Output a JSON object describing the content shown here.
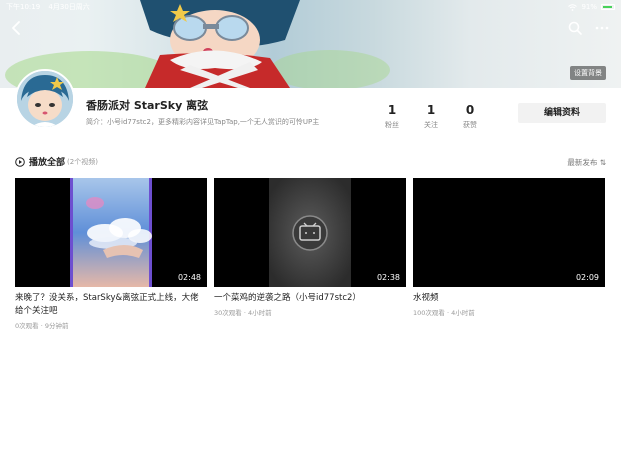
{
  "status_bar": {
    "time": "下午10:19",
    "date": "4月30日周六",
    "battery": "91%"
  },
  "banner": {
    "set_background_label": "设置背景"
  },
  "profile": {
    "username": "香肠派对 StarSky 离弦",
    "bio": "简介：小号id77stc2，更多精彩内容详见TapTap,一个无人赏识的可怜UP主",
    "edit_label": "编辑资料",
    "stats": [
      {
        "value": "1",
        "label": "粉丝"
      },
      {
        "value": "1",
        "label": "关注"
      },
      {
        "value": "0",
        "label": "获赞"
      }
    ]
  },
  "list": {
    "play_all_label": "播放全部",
    "video_count": "(2个视频)",
    "sort_label": "最新发布 ⇅"
  },
  "videos": [
    {
      "title": "来晚了？没关系，StarSky&离弦正式上线，大佬给个关注吧",
      "duration": "02:48",
      "views": "0次观看",
      "time": "9分钟前"
    },
    {
      "title": "一个菜鸡的逆袭之路（小号id77stc2）",
      "duration": "02:38",
      "views": "30次观看",
      "time": "4小时前"
    },
    {
      "title": "水视频",
      "duration": "02:09",
      "views": "100次观看",
      "time": "4小时前"
    }
  ],
  "colors": {
    "primary_text": "#222222",
    "secondary_text": "#888888",
    "button_bg": "#f2f2f2"
  }
}
